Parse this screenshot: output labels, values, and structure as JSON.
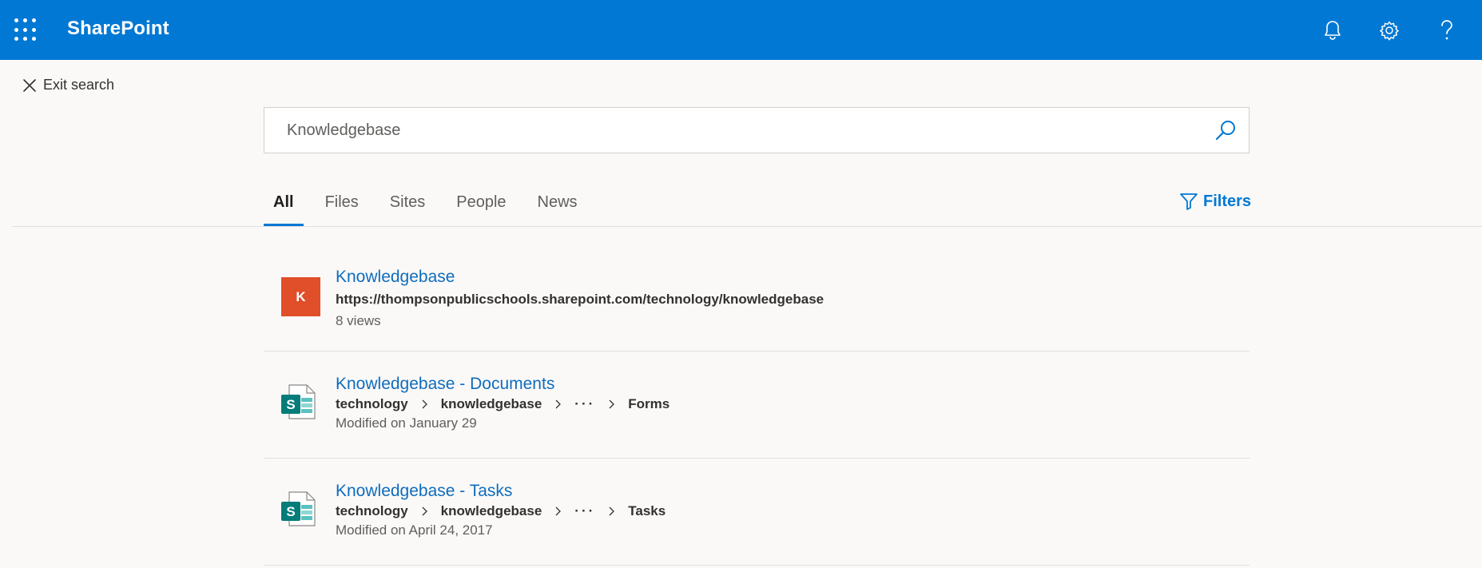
{
  "suitebar": {
    "brand": "SharePoint",
    "colors": {
      "background": "#0078d4",
      "text": "#ffffff"
    },
    "icons": [
      "app-launcher-icon",
      "bell-icon",
      "gear-icon",
      "help-icon"
    ]
  },
  "exit_search": {
    "label": "Exit search",
    "icon": "close-icon"
  },
  "search": {
    "value": "Knowledgebase",
    "icon": "search-icon"
  },
  "tabs": [
    {
      "label": "All",
      "active": true
    },
    {
      "label": "Files",
      "active": false
    },
    {
      "label": "Sites",
      "active": false
    },
    {
      "label": "People",
      "active": false
    },
    {
      "label": "News",
      "active": false
    }
  ],
  "filters": {
    "label": "Filters",
    "icon": "filter-icon",
    "color": "#0078d4"
  },
  "results": [
    {
      "title": "Knowledgebase",
      "tile_letter": "K",
      "tile_color": "#e04f2a",
      "url": "https://thompsonpublicschools.sharepoint.com/technology/knowledgebase",
      "meta": "8 views"
    },
    {
      "title": "Knowledgebase - Documents",
      "icon": "sharepoint-list-icon",
      "path": [
        "technology",
        "knowledgebase",
        "···",
        "Forms"
      ],
      "meta": "Modified on January 29"
    },
    {
      "title": "Knowledgebase - Tasks",
      "icon": "sharepoint-list-icon",
      "path": [
        "technology",
        "knowledgebase",
        "···",
        "Tasks"
      ],
      "meta": "Modified on April 24, 2017"
    }
  ],
  "colors": {
    "link": "#0f6cbd",
    "accent": "#0078d4",
    "page_background": "#faf9f8"
  }
}
